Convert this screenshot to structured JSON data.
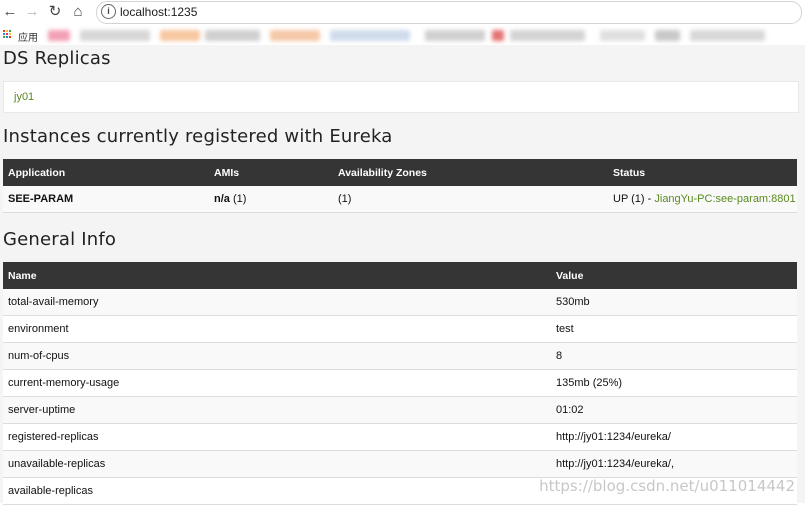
{
  "browser": {
    "url": "localhost:1235",
    "bookmarks_label": "应用"
  },
  "replicas": {
    "title": "DS Replicas",
    "items": [
      "jy01"
    ]
  },
  "instances": {
    "title": "Instances currently registered with Eureka",
    "headers": [
      "Application",
      "AMIs",
      "Availability Zones",
      "Status"
    ],
    "rows": [
      {
        "application": "SEE-PARAM",
        "amis": "n/a",
        "amis_count": "(1)",
        "zones": "(1)",
        "status": "UP (1) -",
        "status_link": "JiangYu-PC:see-param:8801"
      }
    ]
  },
  "general": {
    "title": "General Info",
    "headers": [
      "Name",
      "Value"
    ],
    "rows": [
      {
        "name": "total-avail-memory",
        "value": "530mb"
      },
      {
        "name": "environment",
        "value": "test"
      },
      {
        "name": "num-of-cpus",
        "value": "8"
      },
      {
        "name": "current-memory-usage",
        "value": "135mb (25%)"
      },
      {
        "name": "server-uptime",
        "value": "01:02"
      },
      {
        "name": "registered-replicas",
        "value": "http://jy01:1234/eureka/"
      },
      {
        "name": "unavailable-replicas",
        "value": "http://jy01:1234/eureka/,"
      },
      {
        "name": "available-replicas",
        "value": ""
      }
    ]
  },
  "watermark": "https://blog.csdn.net/u011014442",
  "colors": {
    "header_bg": "#353535",
    "link_green": "#5a8a1f",
    "page_bg": "#f4f4f4"
  }
}
